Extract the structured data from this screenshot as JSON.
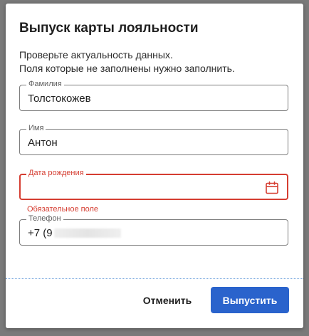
{
  "dialog": {
    "title": "Выпуск карты лояльности",
    "description_line1": "Проверьте актуальность данных.",
    "description_line2": "Поля которые не заполнены нужно заполнить."
  },
  "form": {
    "last_name": {
      "label": "Фамилия",
      "value": "Толстокожев"
    },
    "first_name": {
      "label": "Имя",
      "value": "Антон"
    },
    "birth_date": {
      "label": "Дата рождения",
      "value": "",
      "error": "Обязательное поле"
    },
    "phone": {
      "label": "Телефон",
      "value": "+7 (9"
    }
  },
  "actions": {
    "cancel_label": "Отменить",
    "submit_label": "Выпустить"
  },
  "colors": {
    "accent": "#2a63cc",
    "error": "#d53d31"
  },
  "icons": {
    "date_picker": "calendar-icon"
  }
}
